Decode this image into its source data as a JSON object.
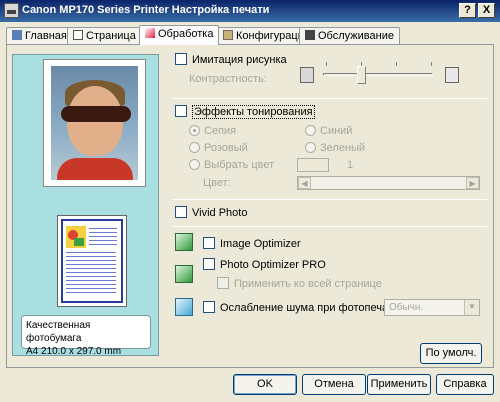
{
  "window": {
    "title": "Canon MP170 Series Printer Настройка печати",
    "help_btn": "?",
    "close_btn": "X"
  },
  "tabs": [
    {
      "label": "Главная",
      "icon": "main-icon"
    },
    {
      "label": "Страница",
      "icon": "page-icon"
    },
    {
      "label": "Обработка",
      "icon": "effects-icon",
      "active": true
    },
    {
      "label": "Конфигурации",
      "icon": "profiles-icon"
    },
    {
      "label": "Обслуживание",
      "icon": "maintenance-icon"
    }
  ],
  "preview": {
    "media_line1": "Качественная фотобумага",
    "media_line2": "A4 210.0 x 297.0 mm"
  },
  "simulate": {
    "label": "Имитация рисунка",
    "contrast_label": "Контрастность:"
  },
  "toning": {
    "label": "Эффекты тонирования",
    "sepia": "Сепия",
    "blue": "Синий",
    "pink": "Розовый",
    "green": "Зеленый",
    "select_color": "Выбрать цвет",
    "color_value": "1",
    "color_label": "Цвет:"
  },
  "vivid": {
    "label": "Vivid Photo"
  },
  "image_optimizer": {
    "label": "Image Optimizer"
  },
  "photo_optimizer": {
    "label": "Photo Optimizer PRO",
    "apply_all": "Применить ко всей странице"
  },
  "noise": {
    "label": "Ослабление шума при фотопечати",
    "level": "Обычн."
  },
  "buttons": {
    "defaults": "По умолч.",
    "ok": "OK",
    "cancel": "Отмена",
    "apply": "Применить",
    "help": "Справка"
  }
}
